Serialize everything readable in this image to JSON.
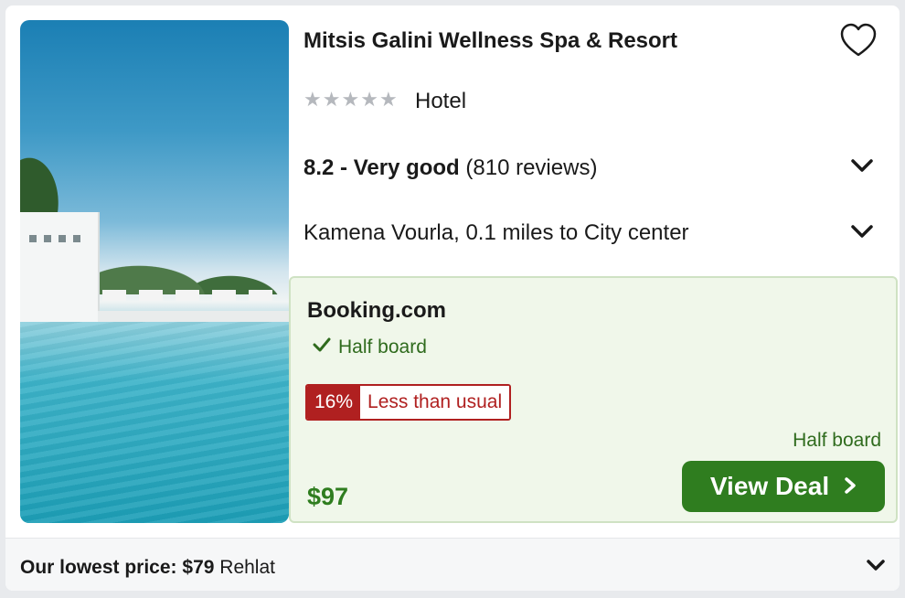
{
  "hotel": {
    "name": "Mitsis Galini Wellness Spa & Resort",
    "stars": 5,
    "type": "Hotel",
    "rating_score": "8.2 - Very good",
    "review_count": "(810 reviews)",
    "location": "Kamena Vourla, 0.1 miles to City center"
  },
  "deal": {
    "provider": "Booking.com",
    "meal_plan": "Half board",
    "discount_pct": "16%",
    "discount_label": "Less than usual",
    "meal_plan_right": "Half board",
    "price": "$97",
    "cta_label": "View Deal"
  },
  "footer": {
    "lowest_label": "Our lowest price:",
    "lowest_price": "$79",
    "lowest_provider": "Rehlat"
  },
  "icons": {
    "favorite": "heart-outline-icon",
    "expand": "chevron-down-icon",
    "check": "check-icon",
    "cta_arrow": "chevron-right-icon"
  },
  "colors": {
    "deal_green": "#2f7d1f",
    "deal_bg": "#f0f7ea",
    "discount_red": "#b02020",
    "star_gray": "#b5b8bd"
  }
}
